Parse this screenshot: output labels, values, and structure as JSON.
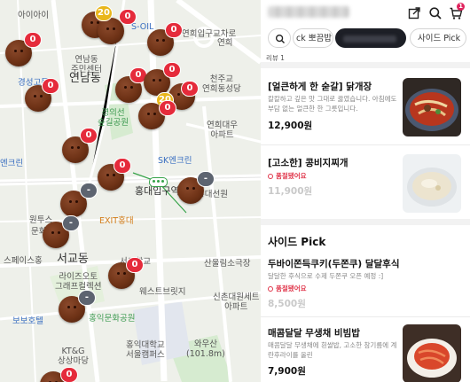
{
  "map": {
    "labels": {
      "airang": "아이아이",
      "gyeonggo": "경성고등",
      "yeonnam_center": "연남동\n주민센터",
      "yeonnam_dong": "연남동",
      "gyeongui": "경의선\n숲길공원",
      "yeonhui_intersection": "연희입구교차로",
      "yeonhui": "연희",
      "soil": "S-OIL",
      "cheonju": "천주교\n연희동성당",
      "yeonhui_apt": "연희대우\n아파트",
      "sk_enclean": "SK엔크린",
      "enclean": "엔크린",
      "hongik_station": "홍대입구역",
      "hongdae_line": "홍대선원",
      "wonto": "원투스",
      "munhwa": "문화",
      "exit_hongdae": "EXIT홍대",
      "spaceshong": "스페이스홍",
      "seogyo": "서교동",
      "seogyo_school": "서교학교",
      "sanullim": "산울림소극장",
      "laura": "라이즈오토\n그래프컬렉션",
      "westbridge": "웨스트브릿지",
      "sinchon": "신촌대원세트\n아파트",
      "bobo": "보보호텔",
      "hongmun": "홍익문화공원",
      "hongik_seoul": "홍익대학교\n서울캠퍼스",
      "wausan": "와우산\n(101.8m)",
      "ktg": "KT&G\n상상마당"
    },
    "pins": [
      {
        "badge": "0",
        "color": "red"
      },
      {
        "badge": "0",
        "color": "red"
      },
      {
        "badge": "0",
        "color": "red"
      },
      {
        "badge": "0",
        "color": "red"
      },
      {
        "badge": "0",
        "color": "red"
      },
      {
        "badge": "0",
        "color": "red"
      },
      {
        "badge": "0",
        "color": "red"
      },
      {
        "badge": "0",
        "color": "red"
      },
      {
        "badge": "0",
        "color": "red"
      },
      {
        "badge": "0",
        "color": "red"
      },
      {
        "badge": "0",
        "color": "red"
      },
      {
        "badge": "0",
        "color": "red"
      },
      {
        "badge": "-",
        "color": "gray"
      },
      {
        "badge": "-",
        "color": "gray"
      },
      {
        "badge": "-",
        "color": "gray"
      },
      {
        "badge": "-",
        "color": "gray"
      },
      {
        "badge": "0",
        "color": "red"
      },
      {
        "badge": "0",
        "color": "red"
      }
    ],
    "clusters": [
      {
        "badge": "20",
        "color": "yellow"
      },
      {
        "badge": "20",
        "color": "yellow"
      }
    ]
  },
  "panel": {
    "top_icons": [
      "share-icon",
      "search-icon",
      "cart-icon"
    ],
    "cart_count": "1",
    "chips": {
      "search_icon": "search-icon",
      "chip1": "ck 뽀끔밥",
      "chip3": "사이드 Pick"
    },
    "cut_text": "리뷰 1",
    "items": [
      {
        "name": "[얼큰하게 한 숟갈] 닭개장",
        "desc": "칼칼하고 깊은 맛 그대로 끓였습니다. 아침에도 부담 없는 얼큰한 한 그릇입니다.",
        "price": "12,900원",
        "sold_out": ""
      },
      {
        "name": "[고소한] 콩비지찌개",
        "desc": "",
        "price": "11,900원",
        "sold_out": "품절됐어요"
      }
    ],
    "section_title": "사이드 Pick",
    "side_items": [
      {
        "name": "두바이쫀득쿠키(두쫀쿠) 달달후식",
        "desc": "달달한 후식으로 수제 두쫀쿠 오픈 예정 :]",
        "price": "8,500원",
        "sold_out": "품절됐어요"
      },
      {
        "name": "매콤달달 무생채 비빔밥",
        "desc": "매콤달달 무생채에 흰쌀밥, 고소한 참기름에 계란후라이를 올린",
        "price": "7,900원",
        "sold_out": ""
      }
    ]
  }
}
